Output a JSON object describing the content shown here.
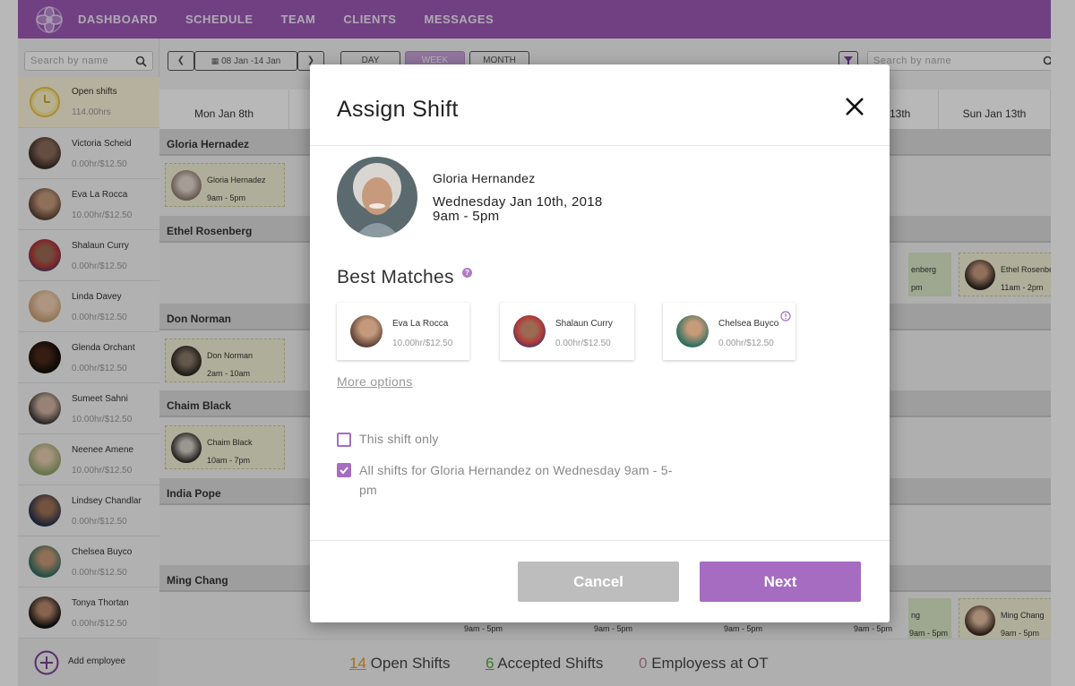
{
  "nav": {
    "items": [
      "DASHBOARD",
      "SCHEDULE",
      "TEAM",
      "CLIENTS",
      "MESSAGES"
    ]
  },
  "sidebar": {
    "search_placeholder": "Search by name",
    "open_shifts": {
      "label": "Open shifts",
      "hours": "114.00hrs"
    },
    "employees": [
      {
        "name": "Victoria Scheid",
        "rate": "0.00hr/$12.50"
      },
      {
        "name": "Eva La Rocca",
        "rate": "10.00hr/$12.50"
      },
      {
        "name": "Shalaun Curry",
        "rate": "0.00hr/$12.50"
      },
      {
        "name": "Linda Davey",
        "rate": "0.00hr/$12.50"
      },
      {
        "name": "Glenda Orchant",
        "rate": "0.00hr/$12.50"
      },
      {
        "name": "Sumeet Sahni",
        "rate": "10.00hr/$12.50"
      },
      {
        "name": "Neenee Amene",
        "rate": "10.00hr/$12.50"
      },
      {
        "name": "Lindsey Chandlar",
        "rate": "0.00hr/$12.50"
      },
      {
        "name": "Chelsea Buyco",
        "rate": "0.00hr/$12.50"
      },
      {
        "name": "Tonya Thortan",
        "rate": "0.00hr/$12.50"
      }
    ],
    "add_employee": "Add employee"
  },
  "toolbar": {
    "date_range": "08 Jan -14 Jan",
    "views": [
      "DAY",
      "WEEK",
      "MONTH"
    ],
    "search_placeholder": "Search by name"
  },
  "schedule": {
    "days": [
      "Mon Jan 8th",
      "",
      "",
      "",
      "",
      "13th",
      "Sun Jan 13th"
    ],
    "rows": [
      {
        "name": "Gloria Hernadez"
      },
      {
        "name": "Ethel Rosenberg"
      },
      {
        "name": "Don Norman"
      },
      {
        "name": "Chaim Black"
      },
      {
        "name": "India Pope"
      },
      {
        "name": "Ming Chang"
      }
    ],
    "shifts": [
      {
        "name": "Gloria Hernadez",
        "time": "9am - 5pm"
      },
      {
        "name": "Don Norman",
        "time": "2am - 10am"
      },
      {
        "name": "Chaim Black",
        "time": "10am - 7pm"
      },
      {
        "name": "enberg",
        "time": "pm"
      },
      {
        "name": "Ethel Rosenberg",
        "time": "11am - 2pm"
      },
      {
        "name": "ng",
        "time": "9am - 5pm"
      },
      {
        "name": "Ming Chang",
        "time": "9am - 5pm"
      }
    ],
    "bottom_times": [
      "9am - 5pm",
      "9am - 5pm",
      "9am - 5pm",
      "9am - 5pm"
    ]
  },
  "footer": {
    "open_count": "14",
    "open_label": "Open Shifts",
    "accepted_count": "6",
    "accepted_label": "Accepted Shifts",
    "ot_count": "0",
    "ot_label": "Employess at OT",
    "colors": {
      "open": "#e39b2a",
      "accepted": "#5aa63a",
      "ot": "#c0809b"
    }
  },
  "modal": {
    "title": "Assign Shift",
    "employee_name": "Gloria Hernandez",
    "date": "Wednesday Jan 10th, 2018",
    "time": "9am - 5pm",
    "best_matches_title": "Best Matches",
    "matches": [
      {
        "name": "Eva La Rocca",
        "rate": "10.00hr/$12.50"
      },
      {
        "name": "Shalaun Curry",
        "rate": "0.00hr/$12.50"
      },
      {
        "name": "Chelsea Buyco",
        "rate": "0.00hr/$12.50"
      }
    ],
    "more_options": "More options",
    "option_this_shift": "This shift only",
    "option_all_shifts": "All shifts for Gloria Hernandez on Wednesday 9am - 5-pm",
    "option_all_checked": true,
    "cancel_label": "Cancel",
    "next_label": "Next",
    "accent": "#a56cc1"
  }
}
